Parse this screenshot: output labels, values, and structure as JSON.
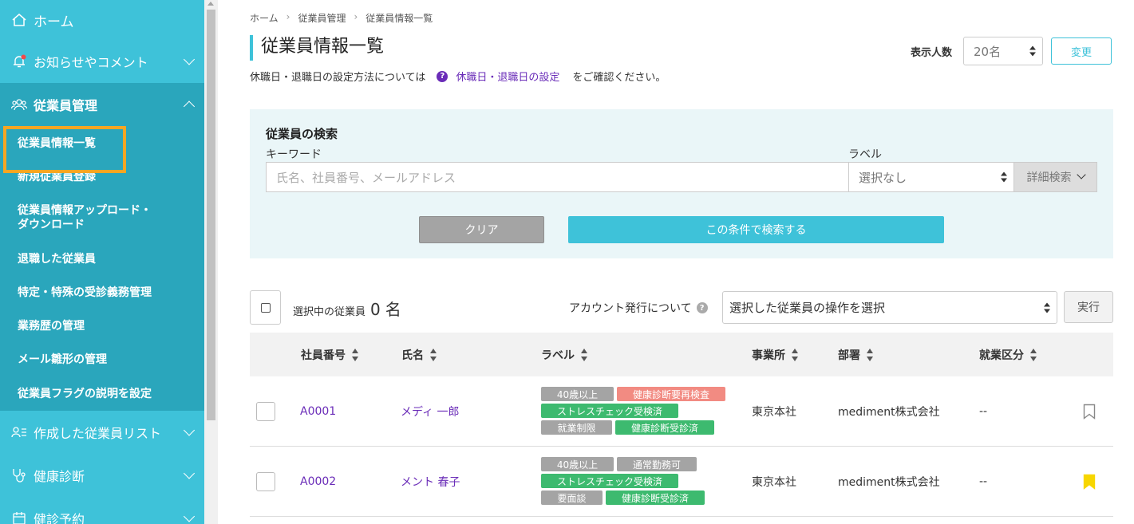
{
  "sidebar": {
    "home": "ホーム",
    "notices": "お知らせやコメント",
    "employee_mgmt": "従業員管理",
    "sub_items": [
      "従業員情報一覧",
      "新規従業員登録",
      "従業員情報アップロード・ダウンロード",
      "退職した従業員",
      "特定・特殊の受診義務管理",
      "業務歴の管理",
      "メール雛形の管理",
      "従業員フラグの説明を設定"
    ],
    "sub_item_3_line1": "従業員情報アップロード・",
    "sub_item_3_line2": "ダウンロード",
    "created_lists": "作成した従業員リスト",
    "health_check": "健康診断",
    "reservation": "健診予約",
    "colors": {
      "bg": "#3ec2d9",
      "active": "#2aa6bc",
      "highlight": "#f5a623"
    }
  },
  "breadcrumb": [
    "ホーム",
    "従業員管理",
    "従業員情報一覧"
  ],
  "page_title": "従業員情報一覧",
  "notice": {
    "prefix": "休職日・退職日の設定方法については",
    "link": "休職日・退職日の設定",
    "suffix": "をご確認ください。"
  },
  "display": {
    "label": "表示人数",
    "value": "20名",
    "button": "変更"
  },
  "search": {
    "title": "従業員の検索",
    "keyword_label": "キーワード",
    "keyword_placeholder": "氏名、社員番号、メールアドレス",
    "label_label": "ラベル",
    "label_value": "選択なし",
    "advanced": "詳細検索",
    "clear": "クリア",
    "submit": "この条件で検索する"
  },
  "bulk": {
    "selected_label": "選択中の従業員",
    "selected_count": "0",
    "selected_unit": "名",
    "account_info": "アカウント発行について",
    "operation_placeholder": "選択した従業員の操作を選択",
    "run": "実行"
  },
  "table": {
    "headers": [
      "社員番号",
      "氏名",
      "ラベル",
      "事業所",
      "部署",
      "就業区分"
    ],
    "rows": [
      {
        "id": "A0001",
        "name": "メディ 一郎",
        "labels": [
          [
            {
              "text": "40歳以上",
              "color": "#a4a4a4"
            },
            {
              "text": "健康診断要再検査",
              "color": "#f28b82"
            }
          ],
          [
            {
              "text": "ストレスチェック受検済",
              "color": "#3dba6f"
            }
          ],
          [
            {
              "text": "就業制限",
              "color": "#a4a4a4"
            },
            {
              "text": "健康診断受診済",
              "color": "#3dba6f"
            }
          ]
        ],
        "office": "東京本社",
        "department": "mediment株式会社",
        "employment": "--",
        "bookmarked": false
      },
      {
        "id": "A0002",
        "name": "メント 春子",
        "labels": [
          [
            {
              "text": "40歳以上",
              "color": "#a4a4a4"
            },
            {
              "text": "通常勤務可",
              "color": "#a4a4a4"
            }
          ],
          [
            {
              "text": "ストレスチェック受検済",
              "color": "#3dba6f"
            }
          ],
          [
            {
              "text": "要面談",
              "color": "#a4a4a4"
            },
            {
              "text": "健康診断受診済",
              "color": "#3dba6f"
            }
          ]
        ],
        "office": "東京本社",
        "department": "mediment株式会社",
        "employment": "--",
        "bookmarked": true
      }
    ]
  }
}
